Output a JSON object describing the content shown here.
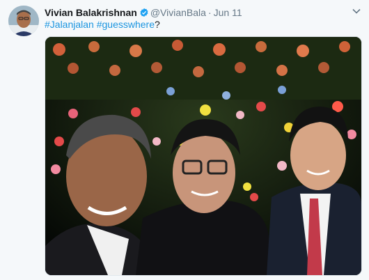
{
  "tweet": {
    "author_name": "Vivian Balakrishnan",
    "handle": "@VivianBala",
    "separator": "·",
    "timestamp": "Jun 11",
    "hashtag_1": "#Jalanjalan",
    "hashtag_sep": " ",
    "hashtag_2": "#guesswhere",
    "text_suffix": "?"
  },
  "icons": {
    "verified": "verified-badge-icon",
    "menu": "chevron-down-icon"
  },
  "colors": {
    "accent": "#1b95e0",
    "text": "#14171a",
    "secondary": "#657786",
    "background": "#f5f8fa"
  }
}
